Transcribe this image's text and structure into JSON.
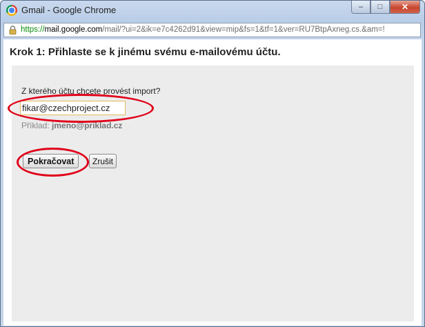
{
  "window": {
    "title": "Gmail - Google Chrome",
    "minimize": "–",
    "maximize": "□",
    "close": "✕"
  },
  "address_bar": {
    "scheme": "https://",
    "host": "mail.google.com",
    "rest": "/mail/?ui=2&ik=e7c4262d91&view=mip&fs=1&tf=1&ver=RU7BtpAxneg.cs.&am=!"
  },
  "dialog": {
    "heading": "Krok 1: Přihlaste se k jinému svému e-mailovému účtu.",
    "question": "Z kterého účtu chcete provést import?",
    "email_value": "fikar@czechproject.cz",
    "example_label": "Příklad:",
    "example_value": "jmeno@priklad.cz",
    "continue_label": "Pokračovat",
    "cancel_label": "Zrušit"
  },
  "colors": {
    "annotation": "#e0001a",
    "url_scheme": "#0a8a0a",
    "panel": "#ececec"
  }
}
